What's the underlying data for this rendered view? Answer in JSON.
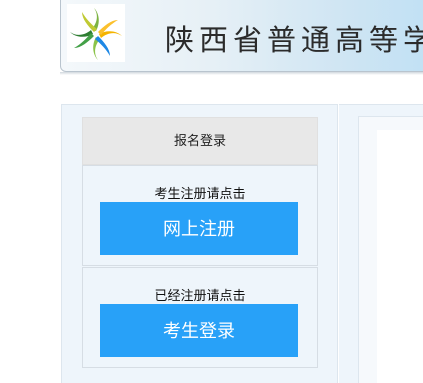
{
  "header": {
    "title": "陕西省普通高等学校",
    "logo_icon": "pinwheel-logo-icon"
  },
  "login": {
    "header_label": "报名登录",
    "register": {
      "prompt": "考生注册请点击",
      "button_label": "网上注册"
    },
    "signin": {
      "prompt": "已经注册请点击",
      "button_label": "考生登录"
    }
  },
  "colors": {
    "button": "#28a1f8",
    "panel_bg": "#eef5fb",
    "header_bg": "#e8e8e8"
  }
}
